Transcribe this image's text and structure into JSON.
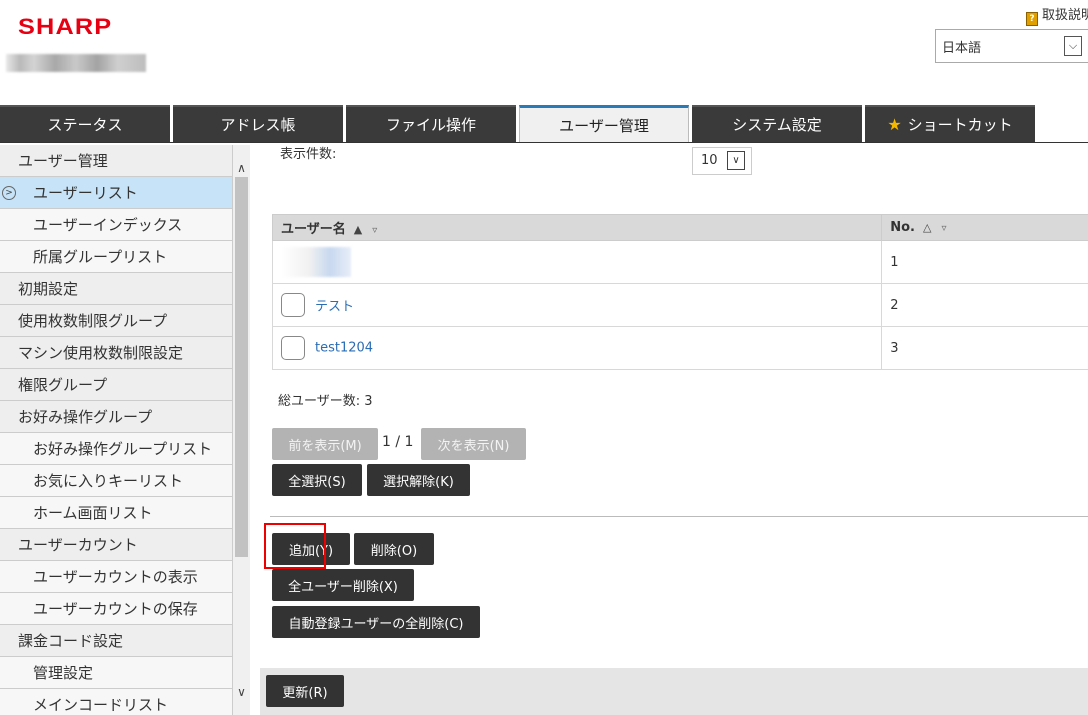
{
  "header": {
    "logo": "SHARP",
    "help_link": "取扱説明",
    "language": "日本語"
  },
  "tabs": [
    {
      "label": "ステータス"
    },
    {
      "label": "アドレス帳"
    },
    {
      "label": "ファイル操作"
    },
    {
      "label": "ユーザー管理"
    },
    {
      "label": "システム設定"
    },
    {
      "label": "ショートカット"
    }
  ],
  "sidebar": {
    "items": [
      {
        "label": "ユーザー管理"
      },
      {
        "label": "ユーザーリスト"
      },
      {
        "label": "ユーザーインデックス"
      },
      {
        "label": "所属グループリスト"
      },
      {
        "label": "初期設定"
      },
      {
        "label": "使用枚数制限グループ"
      },
      {
        "label": "マシン使用枚数制限設定"
      },
      {
        "label": "権限グループ"
      },
      {
        "label": "お好み操作グループ"
      },
      {
        "label": "お好み操作グループリスト"
      },
      {
        "label": "お気に入りキーリスト"
      },
      {
        "label": "ホーム画面リスト"
      },
      {
        "label": "ユーザーカウント"
      },
      {
        "label": "ユーザーカウントの表示"
      },
      {
        "label": "ユーザーカウントの保存"
      },
      {
        "label": "課金コード設定"
      },
      {
        "label": "管理設定"
      },
      {
        "label": "メインコードリスト"
      }
    ]
  },
  "main": {
    "per_page_label": "表示件数:",
    "per_page_value": "10",
    "table": {
      "headers": [
        "ユーザー名",
        "No."
      ],
      "rows": [
        {
          "name": "",
          "no": "1"
        },
        {
          "name": "テスト",
          "no": "2"
        },
        {
          "name": "test1204",
          "no": "3"
        }
      ]
    },
    "total_users": "総ユーザー数:  3",
    "prev_button": "前を表示(M)",
    "page_indicator": "1 / 1",
    "next_button": "次を表示(N)",
    "select_all": "全選択(S)",
    "deselect": "選択解除(K)",
    "add": "追加(Y)",
    "delete": "削除(O)",
    "delete_all_users": "全ユーザー削除(X)",
    "delete_auto_registered": "自動登録ユーザーの全削除(C)",
    "update": "更新(R)"
  }
}
